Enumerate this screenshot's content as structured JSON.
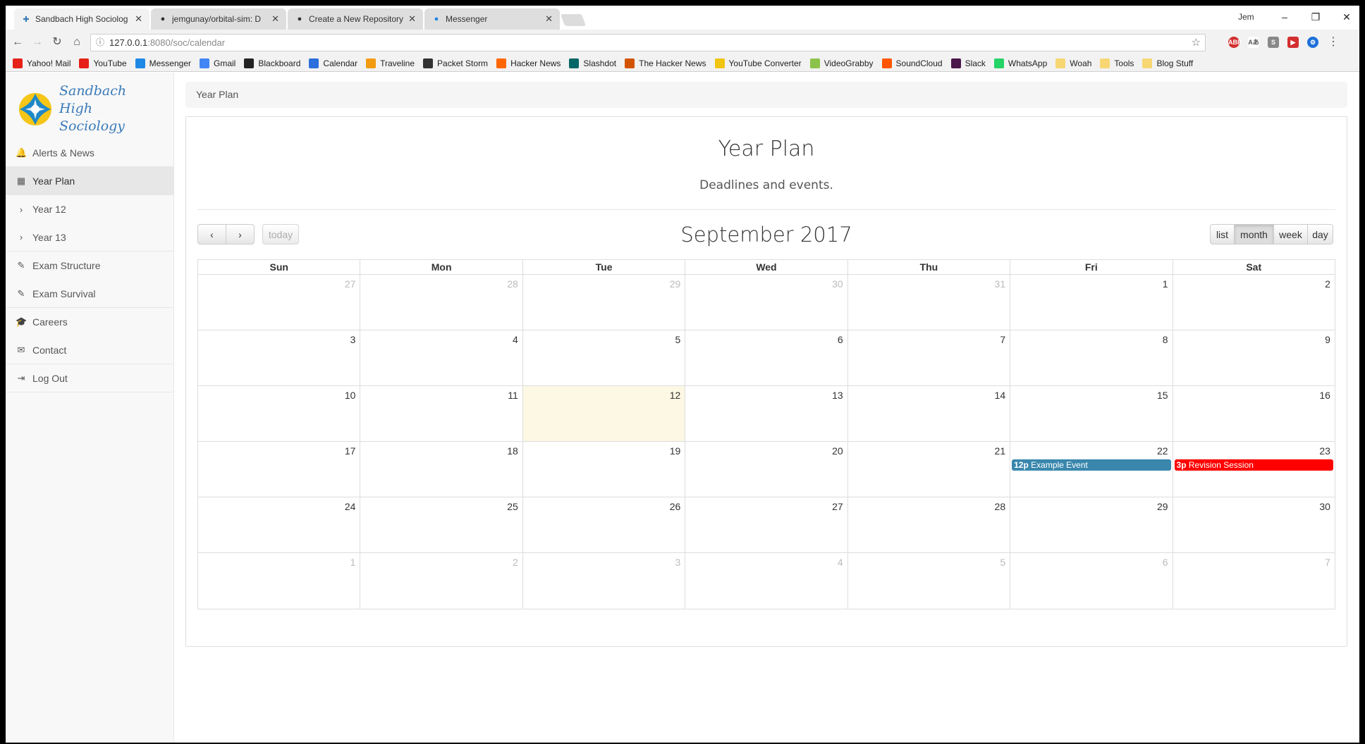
{
  "browser": {
    "tabs": [
      {
        "title": "Sandbach High Sociolog",
        "active": true
      },
      {
        "title": "jemgunay/orbital-sim: D",
        "active": false
      },
      {
        "title": "Create a New Repository",
        "active": false
      },
      {
        "title": "Messenger",
        "active": false
      }
    ],
    "user": "Jem",
    "url_host": "127.0.0.1",
    "url_rest": ":8080/soc/calendar",
    "bookmarks": [
      {
        "label": "Yahoo! Mail",
        "icon": "youtube-icon",
        "color": "#e62117"
      },
      {
        "label": "YouTube",
        "icon": "youtube-icon",
        "color": "#e62117"
      },
      {
        "label": "Messenger",
        "icon": "messenger-icon",
        "color": "#1e88e5"
      },
      {
        "label": "Gmail",
        "icon": "google-icon",
        "color": "#4285f4"
      },
      {
        "label": "Blackboard",
        "icon": "blackboard-icon",
        "color": "#222222"
      },
      {
        "label": "Calendar",
        "icon": "calendar-icon",
        "color": "#2a6fdb"
      },
      {
        "label": "Traveline",
        "icon": "traveline-icon",
        "color": "#f39c12"
      },
      {
        "label": "Packet Storm",
        "icon": "packetstorm-icon",
        "color": "#333333"
      },
      {
        "label": "Hacker News",
        "icon": "hackernews-icon",
        "color": "#ff6600"
      },
      {
        "label": "Slashdot",
        "icon": "slashdot-icon",
        "color": "#006666"
      },
      {
        "label": "The Hacker News",
        "icon": "thehackernews-icon",
        "color": "#d35400"
      },
      {
        "label": "YouTube Converter",
        "icon": "converter-icon",
        "color": "#f1c40f"
      },
      {
        "label": "VideoGrabby",
        "icon": "videograbby-icon",
        "color": "#8bc34a"
      },
      {
        "label": "SoundCloud",
        "icon": "soundcloud-icon",
        "color": "#ff5500"
      },
      {
        "label": "Slack",
        "icon": "slack-icon",
        "color": "#4a154b"
      },
      {
        "label": "WhatsApp",
        "icon": "whatsapp-icon",
        "color": "#25d366"
      },
      {
        "label": "Woah",
        "icon": "folder-icon",
        "color": "#f7d774"
      },
      {
        "label": "Tools",
        "icon": "folder-icon",
        "color": "#f7d774"
      },
      {
        "label": "Blog Stuff",
        "icon": "folder-icon",
        "color": "#f7d774"
      }
    ]
  },
  "app": {
    "brand": "Sandbach High Sociology",
    "nav": [
      {
        "label": "Alerts & News",
        "icon": "bell-icon",
        "glyph": "🔔",
        "active": false
      },
      {
        "label": "Year Plan",
        "icon": "calendar-icon",
        "glyph": "▦",
        "active": true
      },
      {
        "label": "Year 12",
        "icon": "chevron-right-icon",
        "glyph": "›",
        "active": false
      },
      {
        "label": "Year 13",
        "icon": "chevron-right-icon",
        "glyph": "›",
        "active": false
      },
      {
        "label": "Exam Structure",
        "icon": "pencil-icon",
        "glyph": "✎",
        "active": false
      },
      {
        "label": "Exam Survival",
        "icon": "pencil-icon",
        "glyph": "✎",
        "active": false
      },
      {
        "label": "Careers",
        "icon": "graduation-cap-icon",
        "glyph": "🎓",
        "active": false
      },
      {
        "label": "Contact",
        "icon": "envelope-icon",
        "glyph": "✉",
        "active": false
      },
      {
        "label": "Log Out",
        "icon": "logout-icon",
        "glyph": "⇥",
        "active": false
      }
    ],
    "breadcrumb": "Year Plan",
    "page_title": "Year Plan",
    "page_subtitle": "Deadlines and events."
  },
  "calendar": {
    "title": "September 2017",
    "today_label": "today",
    "views": [
      {
        "label": "list",
        "active": false
      },
      {
        "label": "month",
        "active": true
      },
      {
        "label": "week",
        "active": false
      },
      {
        "label": "day",
        "active": false
      }
    ],
    "weekdays": [
      "Sun",
      "Mon",
      "Tue",
      "Wed",
      "Thu",
      "Fri",
      "Sat"
    ],
    "weeks": [
      [
        {
          "d": "27",
          "o": true
        },
        {
          "d": "28",
          "o": true
        },
        {
          "d": "29",
          "o": true
        },
        {
          "d": "30",
          "o": true
        },
        {
          "d": "31",
          "o": true
        },
        {
          "d": "1"
        },
        {
          "d": "2"
        }
      ],
      [
        {
          "d": "3"
        },
        {
          "d": "4"
        },
        {
          "d": "5"
        },
        {
          "d": "6"
        },
        {
          "d": "7"
        },
        {
          "d": "8"
        },
        {
          "d": "9"
        }
      ],
      [
        {
          "d": "10"
        },
        {
          "d": "11"
        },
        {
          "d": "12",
          "today": true
        },
        {
          "d": "13"
        },
        {
          "d": "14"
        },
        {
          "d": "15"
        },
        {
          "d": "16"
        }
      ],
      [
        {
          "d": "17"
        },
        {
          "d": "18"
        },
        {
          "d": "19"
        },
        {
          "d": "20"
        },
        {
          "d": "21"
        },
        {
          "d": "22",
          "event": {
            "time": "12p",
            "title": "Example Event",
            "color": "#3a87ad"
          }
        },
        {
          "d": "23",
          "event": {
            "time": "3p",
            "title": "Revision Session",
            "color": "#ff0000"
          }
        }
      ],
      [
        {
          "d": "24"
        },
        {
          "d": "25"
        },
        {
          "d": "26"
        },
        {
          "d": "27"
        },
        {
          "d": "28"
        },
        {
          "d": "29"
        },
        {
          "d": "30"
        }
      ],
      [
        {
          "d": "1",
          "o": true
        },
        {
          "d": "2",
          "o": true
        },
        {
          "d": "3",
          "o": true
        },
        {
          "d": "4",
          "o": true
        },
        {
          "d": "5",
          "o": true
        },
        {
          "d": "6",
          "o": true
        },
        {
          "d": "7",
          "o": true
        }
      ]
    ]
  }
}
